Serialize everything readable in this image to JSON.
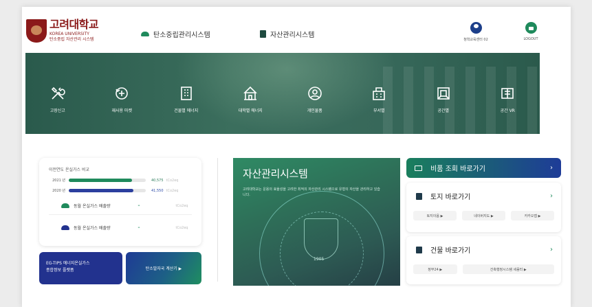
{
  "header": {
    "logo_kr": "고려대학교",
    "logo_en": "KOREA UNIVERSITY",
    "logo_sub": "탄소중립 자산관리 시스템",
    "carbon_link": "탄소중립관리시스템",
    "asset_link": "자산관리시스템",
    "user_name": "청학교육센터 02",
    "logout": "LOGOUT"
  },
  "menu": [
    {
      "label": "고장신고",
      "icon": "tools-icon"
    },
    {
      "label": "재사용 마켓",
      "icon": "recycle-icon"
    },
    {
      "label": "건물별 에너지",
      "icon": "building-icon"
    },
    {
      "label": "대학별 에너지",
      "icon": "school-icon"
    },
    {
      "label": "개인물품",
      "icon": "person-icon"
    },
    {
      "label": "부서별",
      "icon": "department-icon"
    },
    {
      "label": "공간별",
      "icon": "space-icon"
    },
    {
      "label": "공간 VR",
      "icon": "vr-icon"
    }
  ],
  "gas": {
    "title": "이전연도 온실가스 비교",
    "rows": [
      {
        "year": "2021 년",
        "value": "40,575",
        "unit": "tCo2eq",
        "fraction": 0.82
      },
      {
        "year": "2020 년",
        "value": "41,550",
        "unit": "tCo2eq",
        "fraction": 0.84
      }
    ],
    "legend": [
      {
        "label": "동월 온실가스 배출량",
        "dash": "–",
        "unit": "tCo2eq"
      },
      {
        "label": "동월 온실가스 배출량",
        "dash": "–",
        "unit": "tCo2eq"
      }
    ]
  },
  "buttons": {
    "egtips_line1": "EG-TIPS 에너지온실가스",
    "egtips_line2": "종합정보 플랫폼",
    "carbon_calc": "탄소발자국 계산기 ▶"
  },
  "feature": {
    "title": "자산관리시스템",
    "desc": "고려대학교는 운용의 효율성을 고려한 최적의 자산관리 시스템으로 유형의 자산을 관리하고 있습니다.",
    "year": "1905"
  },
  "right": {
    "quick": "비품 조회 바로가기",
    "land_title": "토지 바로가기",
    "land_chips": [
      "토지이음 ▶",
      "네이버지도 ▶",
      "카카오맵 ▶"
    ],
    "bldg_title": "건물 바로가기",
    "bldg_chips": [
      "정부24 ▶",
      "건축행정시스템 세움터 ▶"
    ],
    "arrow": "›"
  },
  "colors": {
    "green": "#1f8a5c",
    "navy": "#22328e",
    "crimson": "#8b1a1a"
  }
}
